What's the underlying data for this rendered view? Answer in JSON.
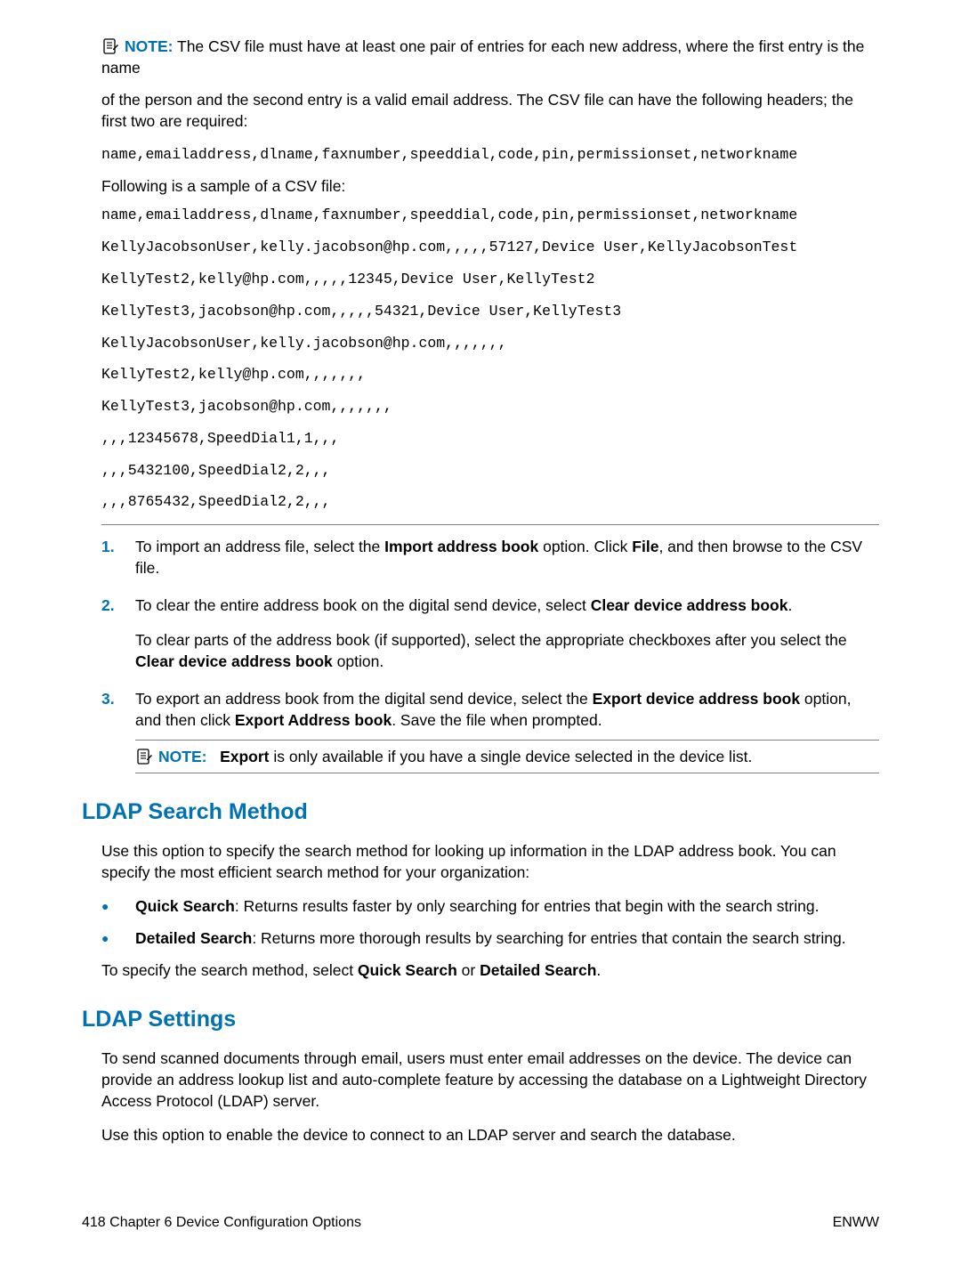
{
  "note1": {
    "label": "NOTE:",
    "text_line1": "The CSV file must have at least one pair of entries for each new address, where the first entry is the name",
    "text_line2": "of the person and the second entry is a valid email address. The CSV file can have the following headers; the first two are required:"
  },
  "code1": "name,emailaddress,dlname,faxnumber,speeddial,code,pin,permissionset,networkname",
  "sample_intro": "Following is a sample of a CSV file:",
  "code_lines": [
    "name,emailaddress,dlname,faxnumber,speeddial,code,pin,permissionset,networkname",
    "KellyJacobsonUser,kelly.jacobson@hp.com,,,,,57127,Device User,KellyJacobsonTest",
    "KellyTest2,kelly@hp.com,,,,,12345,Device User,KellyTest2",
    "KellyTest3,jacobson@hp.com,,,,,54321,Device User,KellyTest3",
    "KellyJacobsonUser,kelly.jacobson@hp.com,,,,,,,",
    "KellyTest2,kelly@hp.com,,,,,,,",
    "KellyTest3,jacobson@hp.com,,,,,,,",
    ",,,12345678,SpeedDial1,1,,,",
    ",,,5432100,SpeedDial2,2,,,",
    ",,,8765432,SpeedDial2,2,,,"
  ],
  "steps": [
    {
      "num": "1.",
      "pre": "To import an address file, select the ",
      "b1": "Import address book",
      "mid": " option. Click ",
      "b2": "File",
      "post": ", and then browse to the CSV file."
    },
    {
      "num": "2.",
      "pre": "To clear the entire address book on the digital send device, select ",
      "b1": "Clear device address book",
      "post": ".",
      "sub_pre": "To clear parts of the address book (if supported), select the appropriate checkboxes after you select the ",
      "sub_b": "Clear device address book",
      "sub_post": " option."
    },
    {
      "num": "3.",
      "pre": "To export an address book from the digital send device, select the ",
      "b1": "Export device address book",
      "mid": " option, and then click ",
      "b2": "Export Address book",
      "post": ". Save the file when prompted.",
      "note_label": "NOTE:",
      "note_b": "Export",
      "note_rest": " is only available if you have a single device selected in the device list."
    }
  ],
  "ldap_search": {
    "title": "LDAP Search Method",
    "p1": "Use this option to specify the search method for looking up information in the LDAP address book. You can specify the most efficient search method for your organization:",
    "bullets": [
      {
        "b": "Quick Search",
        "rest": ": Returns results faster by only searching for entries that begin with the search string."
      },
      {
        "b": "Detailed Search",
        "rest": ": Returns more thorough results by searching for entries that contain the search string."
      }
    ],
    "p2_pre": "To specify the search method, select ",
    "p2_b1": "Quick Search",
    "p2_mid": " or ",
    "p2_b2": "Detailed Search",
    "p2_post": "."
  },
  "ldap_settings": {
    "title": "LDAP Settings",
    "p1": "To send scanned documents through email, users must enter email addresses on the device. The device can provide an address lookup list and auto-complete feature by accessing the database on a Lightweight Directory Access Protocol (LDAP) server.",
    "p2": "Use this option to enable the device to connect to an LDAP server and search the database."
  },
  "footer": {
    "left": "418   Chapter 6   Device Configuration Options",
    "right": "ENWW"
  }
}
